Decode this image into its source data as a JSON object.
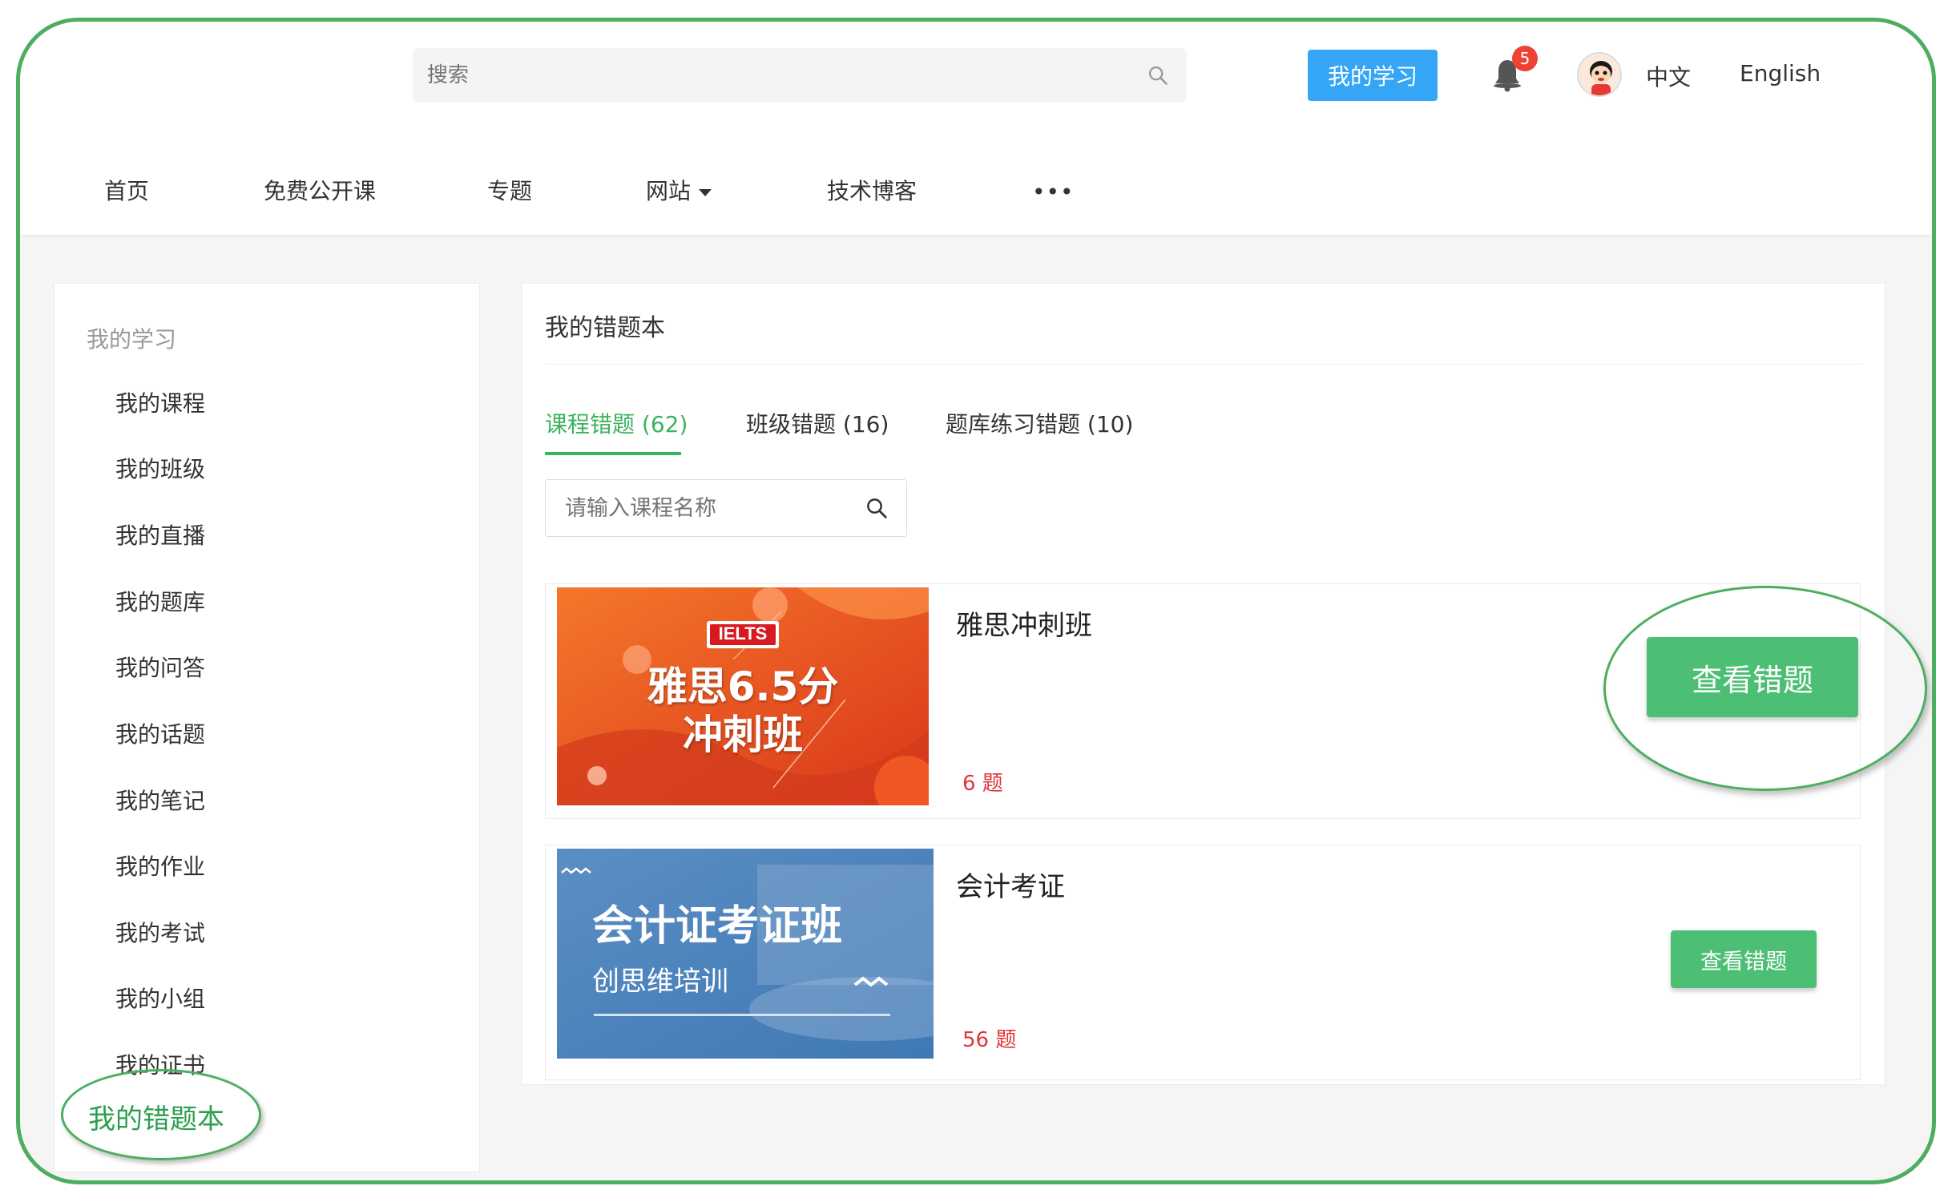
{
  "header": {
    "search_placeholder": "搜索",
    "my_study_button": "我的学习",
    "notification_count": "5",
    "lang_zh": "中文",
    "lang_en": "English"
  },
  "nav": {
    "items": [
      "首页",
      "免费公开课",
      "专题",
      "网站",
      "技术博客"
    ],
    "more": "•••"
  },
  "sidebar": {
    "title": "我的学习",
    "items": [
      "我的课程",
      "我的班级",
      "我的直播",
      "我的题库",
      "我的问答",
      "我的话题",
      "我的笔记",
      "我的作业",
      "我的考试",
      "我的小组",
      "我的证书"
    ],
    "active": "我的错题本"
  },
  "main": {
    "title": "我的错题本",
    "tabs": [
      {
        "label": "课程错题 (62)",
        "active": true
      },
      {
        "label": "班级错题 (16)",
        "active": false
      },
      {
        "label": "题库练习错题 (10)",
        "active": false
      }
    ],
    "search_placeholder": "请输入课程名称",
    "courses": [
      {
        "name": "雅思冲刺班",
        "count": "6 题",
        "button": "查看错题",
        "thumb": {
          "badge": "IELTS",
          "line1": "雅思6.5分",
          "line2": "冲刺班"
        }
      },
      {
        "name": "会计考证",
        "count": "56 题",
        "button": "查看错题",
        "thumb": {
          "line1": "会计证考证班",
          "line2": "创思维培训"
        }
      }
    ]
  },
  "colors": {
    "accent_green": "#3ab35f",
    "button_green": "#4cbf75",
    "primary_blue": "#35a6f5",
    "badge_red": "#f04134",
    "count_red": "#e0363a",
    "annotation_green": "#4cae60"
  },
  "icons": [
    "search-icon",
    "bell-icon",
    "avatar",
    "caret-down-icon",
    "more-icon"
  ]
}
